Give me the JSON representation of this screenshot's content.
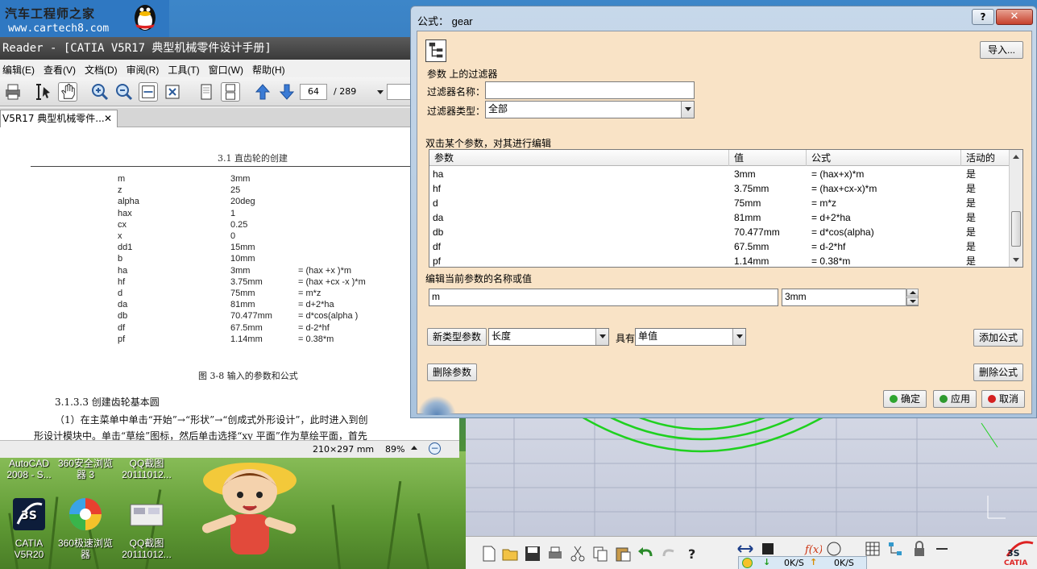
{
  "desktop": {
    "logo_text": "汽车工程师之家",
    "logo_url": "www.cartech8.com",
    "icons": [
      {
        "label": "AutoCAD\n2008 - S..."
      },
      {
        "label": "360安全浏览\n器 3"
      },
      {
        "label": "QQ截图\n20111012..."
      },
      {
        "label": "CATIA\nV5R20"
      },
      {
        "label": "360极速浏览\n器"
      },
      {
        "label": "QQ截图\n20111012..."
      }
    ]
  },
  "reader": {
    "title": "Reader - [CATIA V5R17 典型机械零件设计手册]",
    "menu": [
      "编辑(E)",
      "查看(V)",
      "文档(D)",
      "审阅(R)",
      "工具(T)",
      "窗口(W)",
      "帮助(H)"
    ],
    "page_current": "64",
    "page_total": "/ 289",
    "tab_label": "V5R17 典型机械零件...",
    "tab_close": "✕",
    "doc_header": "3.1  直齿轮的创建",
    "params": [
      {
        "name": "m",
        "value": "3mm",
        "formula": ""
      },
      {
        "name": "z",
        "value": "25",
        "formula": ""
      },
      {
        "name": "alpha",
        "value": "20deg",
        "formula": ""
      },
      {
        "name": "hax",
        "value": "1",
        "formula": ""
      },
      {
        "name": "cx",
        "value": "0.25",
        "formula": ""
      },
      {
        "name": "x",
        "value": "0",
        "formula": ""
      },
      {
        "name": "dd1",
        "value": "15mm",
        "formula": ""
      },
      {
        "name": "b",
        "value": "10mm",
        "formula": ""
      },
      {
        "name": "ha",
        "value": "3mm",
        "formula": "= (hax +x )*m"
      },
      {
        "name": "hf",
        "value": "3.75mm",
        "formula": "= (hax +cx -x )*m"
      },
      {
        "name": "d",
        "value": "75mm",
        "formula": "= m*z"
      },
      {
        "name": "da",
        "value": "81mm",
        "formula": "= d+2*ha"
      },
      {
        "name": "db",
        "value": "70.477mm",
        "formula": "= d*cos(alpha )"
      },
      {
        "name": "df",
        "value": "67.5mm",
        "formula": "= d-2*hf"
      },
      {
        "name": "pf",
        "value": "1.14mm",
        "formula": "= 0.38*m"
      }
    ],
    "caption": "图 3-8   输入的参数和公式",
    "section": "3.1.3.3   创建齿轮基本圆",
    "para1": "（1）在主菜单中单击“开始”→“形状”→“创成式外形设计”，此时进入到创",
    "para2": "形设计模块中。单击“草绘”图标，然后单击选择“xy 平面”作为草绘平面，首先",
    "status_size": "210×297 mm",
    "status_zoom": "89%"
  },
  "dialog": {
    "title": "公式： gear",
    "help": "?",
    "close": "✕",
    "import_label": "导入...",
    "filter_section": "参数 上的过滤器",
    "filter_name_label": "过滤器名称：",
    "filter_name_value": "",
    "filter_type_label": "过滤器类型：",
    "filter_type_value": "全部",
    "edit_hint": "双击某个参数，对其进行编辑",
    "columns": [
      "参数",
      "值",
      "公式",
      "活动的"
    ],
    "rows": [
      {
        "param": "ha",
        "value": "3mm",
        "formula": "= (hax+x)*m",
        "active": "是"
      },
      {
        "param": "hf",
        "value": "3.75mm",
        "formula": "= (hax+cx-x)*m",
        "active": "是"
      },
      {
        "param": "d",
        "value": "75mm",
        "formula": "= m*z",
        "active": "是"
      },
      {
        "param": "da",
        "value": "81mm",
        "formula": "= d+2*ha",
        "active": "是"
      },
      {
        "param": "db",
        "value": "70.477mm",
        "formula": "= d*cos(alpha)",
        "active": "是"
      },
      {
        "param": "df",
        "value": "67.5mm",
        "formula": "= d-2*hf",
        "active": "是"
      },
      {
        "param": "pf",
        "value": "1.14mm",
        "formula": "= 0.38*m",
        "active": "是"
      }
    ],
    "edit_label": "编辑当前参数的名称或值",
    "edit_name": "m",
    "edit_value": "3mm",
    "new_param_label": "新类型参数",
    "new_param_type": "长度",
    "with_label": "具有",
    "with_value": "单值",
    "add_formula_label": "添加公式",
    "delete_param_label": "删除参数",
    "delete_formula_label": "删除公式",
    "ok_label": "确定",
    "apply_label": "应用",
    "cancel_label": "取消",
    "colors": {
      "ok": "#2fa52f",
      "apply": "#2f9a2f",
      "cancel": "#d42020",
      "body": "#f9e3c6"
    }
  },
  "catia": {
    "net_down": "0K/S",
    "net_up": "0K/S",
    "logo": "CATIA"
  }
}
